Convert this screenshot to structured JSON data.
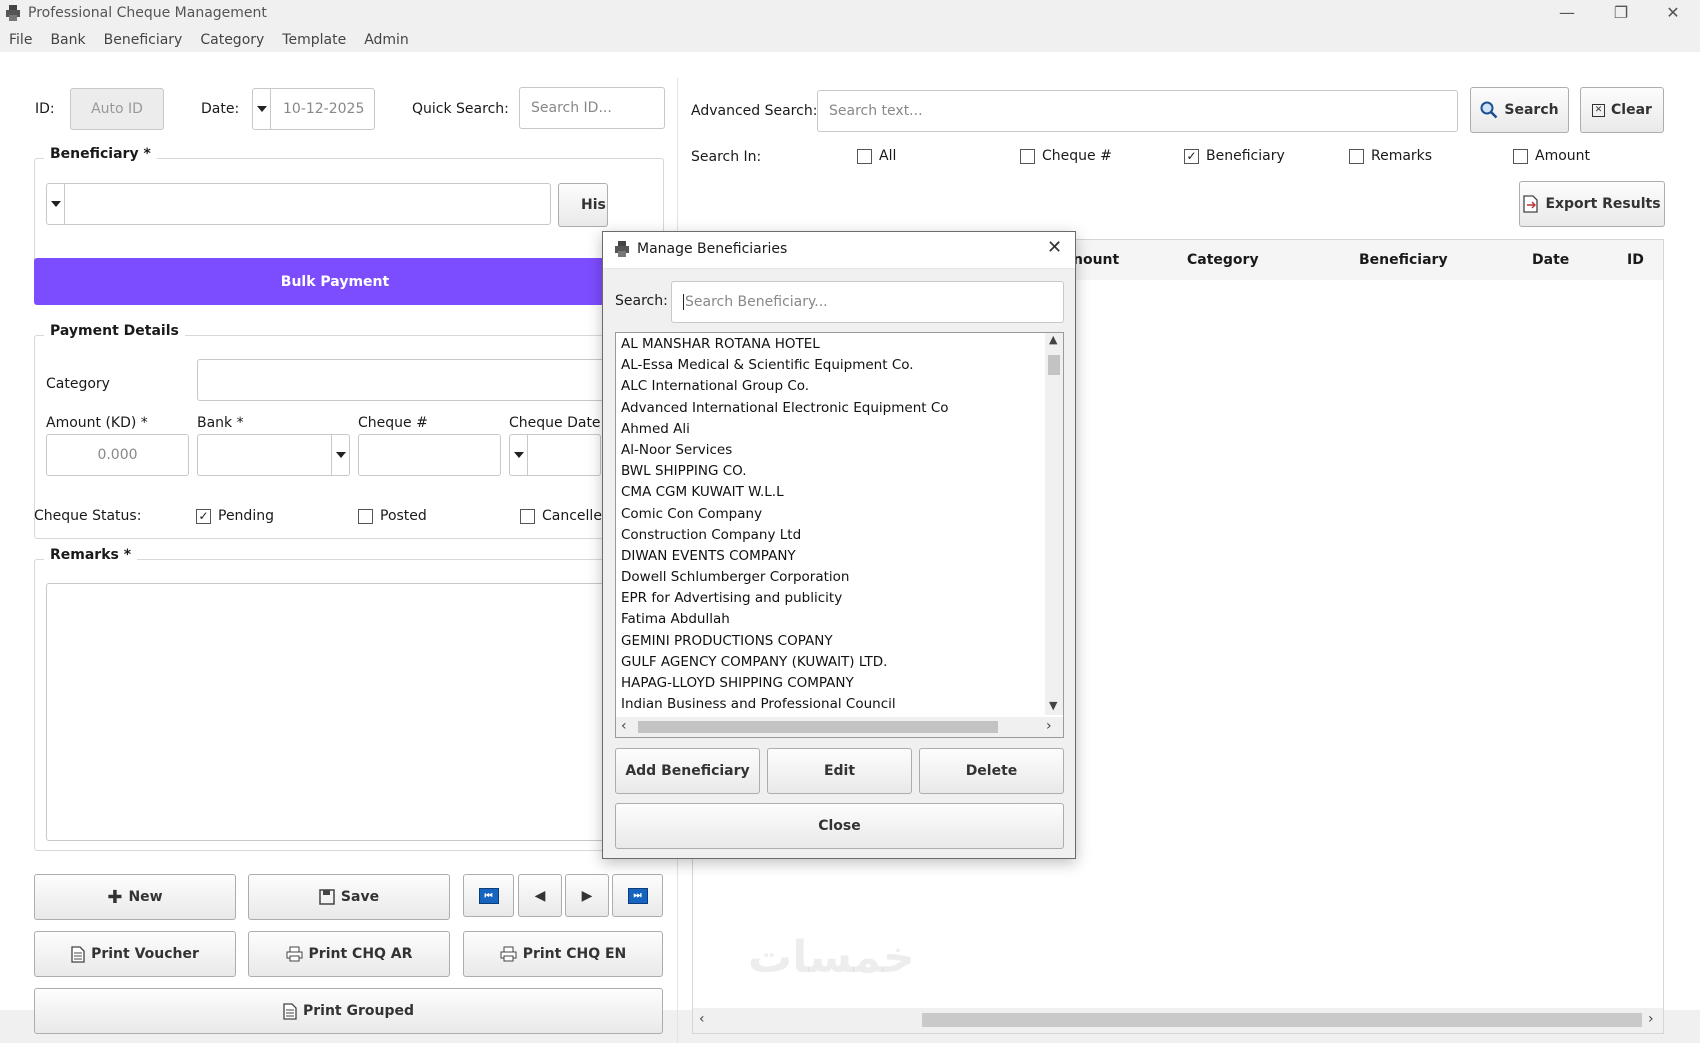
{
  "window": {
    "title": "Professional Cheque Management",
    "controls": {
      "minimize": "—",
      "restore": "❐",
      "close": "✕"
    }
  },
  "menu": [
    "File",
    "Bank",
    "Beneficiary",
    "Category",
    "Template",
    "Admin"
  ],
  "form": {
    "id_label": "ID:",
    "id_value": "Auto ID",
    "date_label": "Date:",
    "date_value": "10-12-2025",
    "quick_search_label": "Quick Search:",
    "quick_search_placeholder": "Search ID...",
    "beneficiary_group": "Beneficiary *",
    "history_button": "His",
    "bulk_payment_button": "Bulk Payment",
    "payment_details_group": "Payment Details",
    "category_label": "Category",
    "amount_label": "Amount (KD) *",
    "amount_value": "0.000",
    "bank_label": "Bank *",
    "cheque_no_label": "Cheque #",
    "cheque_date_label": "Cheque Date",
    "cheque_status_label": "Cheque Status:",
    "status_options": [
      {
        "label": "Pending",
        "checked": true
      },
      {
        "label": "Posted",
        "checked": false
      },
      {
        "label": "Cancelled",
        "checked": false
      }
    ],
    "remarks_group": "Remarks *"
  },
  "actions": {
    "new": "New",
    "save": "Save",
    "nav_first_icon": "first-record-icon",
    "nav_prev": "◀",
    "nav_next": "▶",
    "nav_last_icon": "last-record-icon",
    "print_voucher": "Print Voucher",
    "print_chq_ar": "Print CHQ AR",
    "print_chq_en": "Print CHQ EN",
    "print_grouped": "Print Grouped"
  },
  "search_panel": {
    "advanced_label": "Advanced Search:",
    "advanced_placeholder": "Search text...",
    "search_button": "Search",
    "clear_button": "Clear",
    "search_in_label": "Search In:",
    "search_in_options": [
      {
        "label": "All",
        "checked": false
      },
      {
        "label": "Cheque #",
        "checked": false
      },
      {
        "label": "Beneficiary",
        "checked": true
      },
      {
        "label": "Remarks",
        "checked": false
      },
      {
        "label": "Amount",
        "checked": false
      }
    ],
    "export_button": "Export Results",
    "grid_columns": [
      "nount",
      "Category",
      "Beneficiary",
      "Date",
      "ID"
    ]
  },
  "dialog": {
    "title": "Manage Beneficiaries",
    "search_label": "Search:",
    "search_placeholder": "Search Beneficiary...",
    "beneficiaries": [
      "AL MANSHAR ROTANA HOTEL",
      "AL-Essa Medical & Scientific Equipment Co.",
      "ALC International Group Co.",
      "Advanced International Electronic Equipment Co",
      "Ahmed Ali",
      "Al-Noor Services",
      "BWL SHIPPING CO.",
      "CMA CGM KUWAIT W.L.L",
      "Comic Con Company",
      "Construction Company Ltd",
      "DIWAN EVENTS COMPANY",
      "Dowell Schlumberger Corporation",
      "EPR for Advertising and publicity",
      "Fatima Abdullah",
      "GEMINI PRODUCTIONS COPANY",
      "GULF AGENCY COMPANY (KUWAIT) LTD.",
      "HAPAG-LLOYD SHIPPING COMPANY",
      "Indian Business and Professional Council"
    ],
    "add_button": "Add Beneficiary",
    "edit_button": "Edit",
    "delete_button": "Delete",
    "close_button": "Close"
  },
  "watermark": "خمسات",
  "colors": {
    "accent_purple": "#7c4dff",
    "window_bg": "#f0f0f0",
    "client_bg": "#ffffff"
  }
}
